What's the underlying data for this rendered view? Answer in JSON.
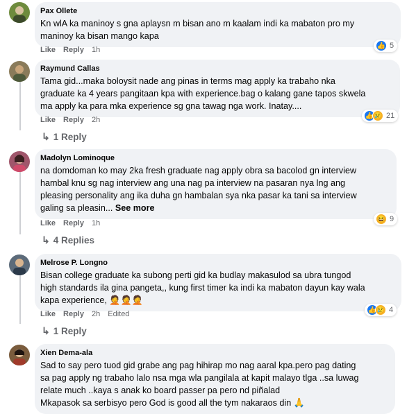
{
  "comments": [
    {
      "author": "Pax Ollete",
      "lines": [
        "Kn wlA ka maninoy s gna aplaysn m bisan ano m kaalam indi ka mabaton pro my",
        "maninoy ka bisan mango kapa"
      ],
      "like": "Like",
      "reply": "Reply",
      "time": "1h",
      "reaction_count": "5",
      "avatar_color": "#6e8b3d"
    },
    {
      "author": "Raymund Callas",
      "lines": [
        "Tama gid...maka boloysit nade ang pinas in terms mag apply ka trabaho nka",
        "graduate ka 4 years pangitaan kpa with experience.bag o kalang gane tapos skwela",
        "ma apply ka para mka experience sg gna tawag nga work. Inatay...."
      ],
      "like": "Like",
      "reply": "Reply",
      "time": "2h",
      "reaction_count": "21",
      "replies": "1 Reply",
      "avatar_color": "#8a7b5a"
    },
    {
      "author": "Madolyn Lominoque",
      "lines": [
        "na domdoman ko may 2ka fresh graduate nag apply obra sa bacolod gn interview",
        "hambal knu sg nag interview ang una nag pa interview na pasaran nya lng ang",
        "pleasing personality ang ika duha gn hambalan sya nka pasar ka tani sa interview",
        "galing sa pleasin..."
      ],
      "see_more": "See more",
      "like": "Like",
      "reply": "Reply",
      "time": "1h",
      "reaction_count": "9",
      "replies": "4 Replies",
      "avatar_color": "#a0566b"
    },
    {
      "author": "Melrose P. Longno",
      "lines": [
        "Bisan college graduate ka subong perti gid ka budlay makasulod sa ubra tungod",
        "high standards ila gina pangeta,, kung first timer ka indi ka mabaton dayun kay wala",
        "kapa experience,"
      ],
      "emoji": "🤦🤦🤦",
      "like": "Like",
      "reply": "Reply",
      "time": "2h",
      "edited": "Edited",
      "reaction_count": "4",
      "replies": "1 Reply",
      "avatar_color": "#5c6b7a"
    },
    {
      "author": "Xien Dema-ala",
      "lines": [
        "Sad to say pero tuod gid grabe ang pag hihirap mo nag aaral kpa.pero pag dating",
        "sa pag apply ng trabaho lalo nsa mga wla pangilala at kapit malayo tlga ..sa luwag",
        "relate much ..kaya s anak ko board passer pa pero nd piñalad",
        "Mkapasok sa serbisyo pero God is good all the tym nakaraos din"
      ],
      "emoji": "🙏",
      "avatar_color": "#7a5c3d"
    }
  ]
}
